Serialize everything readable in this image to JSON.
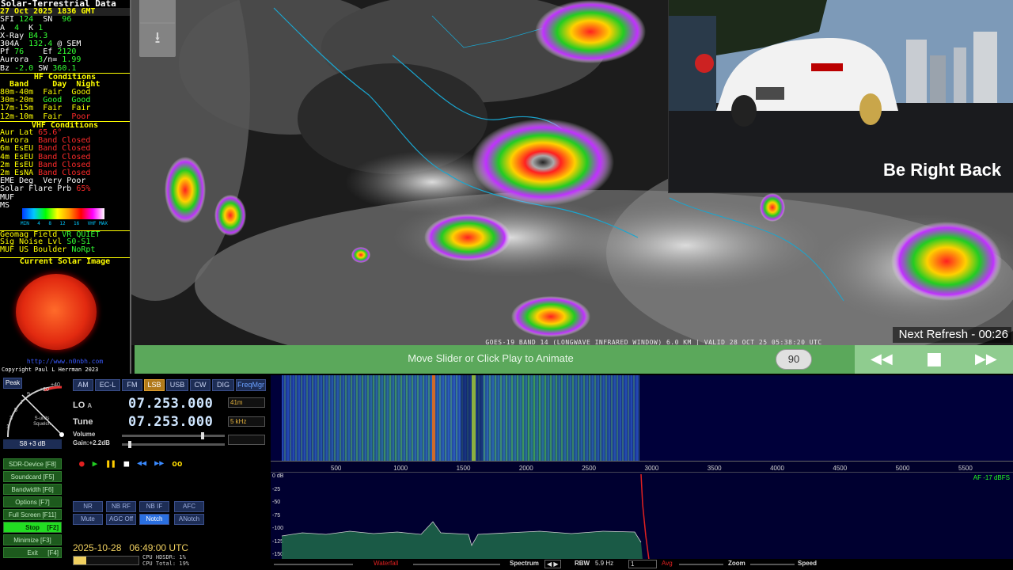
{
  "solar": {
    "title": "Solar-Terrestrial Data",
    "date": "27 Oct 2025 1836 GMT",
    "sfi_label": "SFI",
    "sfi": "124",
    "sn_label": "SN",
    "sn": "96",
    "a_label": "A",
    "a": "4",
    "k_label": "K",
    "k": "1",
    "xray_label": "X-Ray",
    "xray": "B4.3",
    "304a_label": "304A",
    "304a": "132.4",
    "sem": "@ SEM",
    "pf_label": "Pf",
    "pf": "76",
    "ef_label": "Ef",
    "ef": "2120",
    "aurora_label": "Aurora",
    "aurora": "3",
    "n_label": "/n=",
    "n": "1.99",
    "bz_label": "Bz",
    "bz": "-2.0",
    "sw_label": "SW",
    "sw": "360.1",
    "hf_title": "HF Conditions",
    "hf_headers": [
      "Band",
      "Day",
      "Night"
    ],
    "hf_rows": [
      {
        "band": "80m-40m",
        "day": "Fair",
        "night": "Good",
        "dc": "yl",
        "nc": "yl"
      },
      {
        "band": "30m-20m",
        "day": "Good",
        "night": "Good",
        "dc": "gr",
        "nc": "gr"
      },
      {
        "band": "17m-15m",
        "day": "Fair",
        "night": "Fair",
        "dc": "yl",
        "nc": "yl"
      },
      {
        "band": "12m-10m",
        "day": "Fair",
        "night": "Poor",
        "dc": "yl",
        "nc": "rd"
      }
    ],
    "vhf_title": "VHF Conditions",
    "vhf_rows": [
      {
        "label": "Aur Lat",
        "value": "65.6°"
      },
      {
        "label": "Aurora",
        "value": "Band Closed"
      },
      {
        "label": "6m EsEU",
        "value": "Band Closed"
      },
      {
        "label": "4m EsEU",
        "value": "Band Closed"
      },
      {
        "label": "2m EsEU",
        "value": "Band Closed"
      },
      {
        "label": "2m EsNA",
        "value": "Band Closed"
      }
    ],
    "eme_label": "EME Deg",
    "eme": "Very Poor",
    "flare_label": "Solar Flare Prb",
    "flare": "65%",
    "muf_label": "MUF",
    "ms_label": "MS",
    "scale_ticks": [
      "MIN",
      "4",
      "8",
      "12",
      "16",
      "VHF MAX"
    ],
    "geomag_label": "Geomag Field",
    "geomag": "VR QUIET",
    "noise_label": "Sig Noise Lvl",
    "noise": "S0-S1",
    "mufb_label": "MUF US Boulder",
    "mufb": "NoRpt",
    "img_title": "Current Solar Image",
    "site": "http://www.n0nbh.com",
    "copyright": "Copyright Paul L Herrman 2023"
  },
  "map": {
    "caption": "GOES-19 BAND 14 (LONGWAVE INFRARED WINDOW) 6.0 KM | VALID 28 OCT 25 05:38:20 UTC",
    "next_refresh": "Next Refresh - 00:26",
    "slider_label": "Move Slider or Click Play to Animate",
    "frame": "90"
  },
  "cam": {
    "overlay": "Be Right Back"
  },
  "sdr": {
    "peak": "Peak",
    "smeter_title": "S-units Squelch",
    "smeter_reading": "S8 +3 dB",
    "dial_labels": [
      "+40",
      "+20",
      "9",
      "7",
      "5",
      "3",
      "1"
    ],
    "modes": [
      "AM",
      "EC-L",
      "FM",
      "LSB",
      "USB",
      "CW",
      "DIG",
      "FreqMgr"
    ],
    "active_mode": "LSB",
    "lo_label": "LO",
    "lo_a": "A",
    "lo_freq": "07.253.000",
    "tune_label": "Tune",
    "tune_freq": "07.253.000",
    "band_dd": "41m",
    "step_dd": "5 kHz",
    "volume_label": "Volume",
    "gain_label": "Gain:+2.2dB",
    "side_buttons": [
      {
        "label": "SDR-Device [F8]"
      },
      {
        "label": "Soundcard [F5]"
      },
      {
        "label": "Bandwidth [F6]"
      },
      {
        "label": "Options [F7]"
      },
      {
        "label": "Full Screen [F11]"
      },
      {
        "label": "Stop",
        "key": "[F2]"
      },
      {
        "label": "Minimize [F3]"
      },
      {
        "label": "Exit",
        "key": "[F4]"
      }
    ],
    "dsp_row1": [
      "NR",
      "NB RF",
      "NB IF",
      "AFC"
    ],
    "dsp_row2": [
      "Mute",
      "AGC Off",
      "Notch",
      "ANotch"
    ],
    "active_dsp": "Notch",
    "datetime": "2025-10-28   06:49:00 UTC",
    "cpu_hdsdr": "CPU HDSDR: 1%",
    "cpu_total": "CPU Total: 19%"
  },
  "spectrum": {
    "freq_ticks": [
      "500",
      "1000",
      "1500",
      "2000",
      "2500",
      "3000",
      "3500",
      "4000",
      "4500",
      "5000",
      "5500"
    ],
    "db_ticks": [
      "0 dB",
      "-25",
      "-50",
      "-75",
      "-100",
      "-125",
      "-150"
    ],
    "af_label": "AF -17 dBFS",
    "bottom": {
      "waterfall": "Waterfall",
      "spectrum": "Spectrum",
      "rbw_label": "RBW",
      "rbw": "5.9 Hz",
      "avg_num": "1",
      "avg": "Avg",
      "zoom": "Zoom",
      "speed": "Speed"
    }
  },
  "colors": {
    "accent_green": "#33ff33",
    "warn_red": "#ff2a2a",
    "yellow": "#ffff00",
    "active_mode": "#b0791a",
    "notch_blue": "#2a6fe0"
  }
}
